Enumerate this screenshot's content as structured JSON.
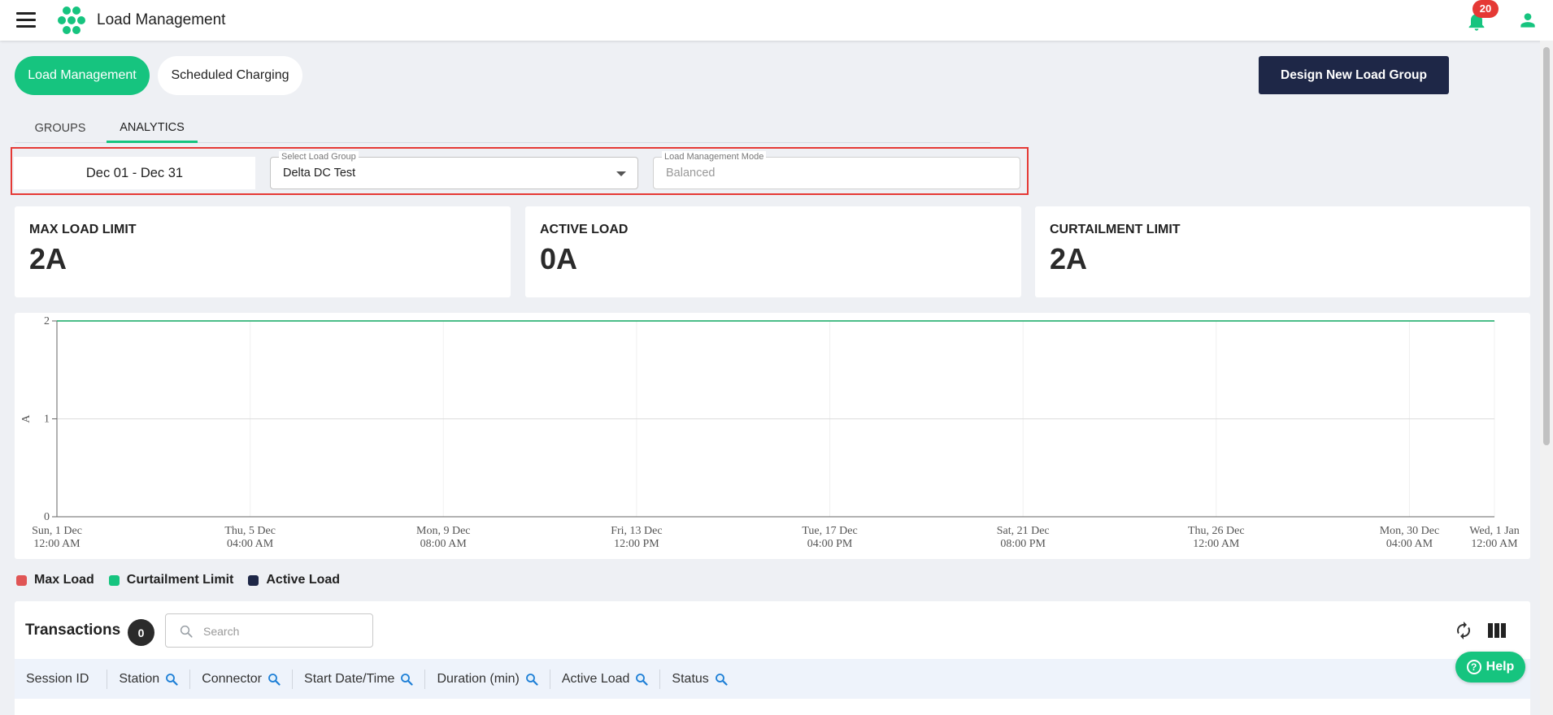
{
  "header": {
    "title": "Load Management",
    "notification_count": "20"
  },
  "top_nav": {
    "pills": [
      {
        "label": "Load Management",
        "active": true
      },
      {
        "label": "Scheduled Charging",
        "active": false
      }
    ],
    "design_button": "Design New Load Group"
  },
  "tabs": [
    {
      "label": "GROUPS",
      "active": false
    },
    {
      "label": "ANALYTICS",
      "active": true
    }
  ],
  "filters": {
    "date_range": "Dec 01 - Dec 31",
    "load_group": {
      "legend": "Select Load Group",
      "value": "Delta DC Test"
    },
    "mode": {
      "legend": "Load Management Mode",
      "value": "Balanced"
    }
  },
  "stats": [
    {
      "label": "MAX LOAD LIMIT",
      "value": "2A"
    },
    {
      "label": "ACTIVE LOAD",
      "value": "0A"
    },
    {
      "label": "CURTAILMENT LIMIT",
      "value": "2A"
    }
  ],
  "chart_data": {
    "type": "line",
    "ylabel": "A",
    "ylim": [
      0,
      2
    ],
    "yticks": [
      "0",
      "1",
      "2"
    ],
    "x_ticks": [
      {
        "line1": "Sun, 1 Dec",
        "line2": "12:00 AM"
      },
      {
        "line1": "Thu, 5 Dec",
        "line2": "04:00 AM"
      },
      {
        "line1": "Mon, 9 Dec",
        "line2": "08:00 AM"
      },
      {
        "line1": "Fri, 13 Dec",
        "line2": "12:00 PM"
      },
      {
        "line1": "Tue, 17 Dec",
        "line2": "04:00 PM"
      },
      {
        "line1": "Sat, 21 Dec",
        "line2": "08:00 PM"
      },
      {
        "line1": "Thu, 26 Dec",
        "line2": "12:00 AM"
      },
      {
        "line1": "Mon, 30 Dec",
        "line2": "04:00 AM"
      },
      {
        "line1": "Wed, 1 Jan",
        "line2": "12:00 AM"
      }
    ],
    "x_range": [
      "2024-12-01T00:00",
      "2025-01-01T00:00"
    ],
    "series": [
      {
        "name": "Max Load",
        "color": "#e05555",
        "x": [
          "2024-12-01T00:00",
          "2025-01-01T00:00"
        ],
        "values": [
          2,
          2
        ]
      },
      {
        "name": "Curtailment Limit",
        "color": "#16c47f",
        "x": [
          "2024-12-01T00:00",
          "2025-01-01T00:00"
        ],
        "values": [
          2,
          2
        ]
      },
      {
        "name": "Active Load",
        "color": "#1e2747",
        "x": [],
        "values": []
      }
    ],
    "grid": true,
    "legend_position": "bottom-left"
  },
  "transactions": {
    "title": "Transactions",
    "count": "0",
    "search_placeholder": "Search",
    "columns": [
      "Session ID",
      "Station",
      "Connector",
      "Start Date/Time",
      "Duration (min)",
      "Active Load",
      "Status"
    ]
  },
  "help_label": "Help",
  "colors": {
    "accent": "#16c47f",
    "dark": "#1e2747",
    "alert": "#e53935"
  }
}
